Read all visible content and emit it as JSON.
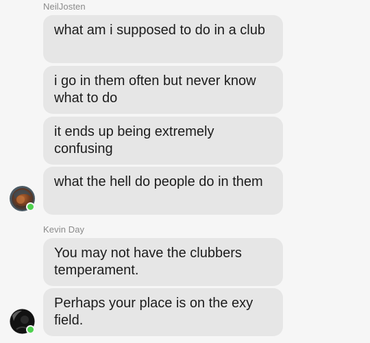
{
  "groups": [
    {
      "sender": "NeilJosten",
      "messages": [
        "what am i supposed to do in a club",
        "i go in them often but never know what to do",
        "it ends up being extremely confusing",
        "what the hell do people do in them"
      ],
      "avatar": {
        "icon": "user-avatar-icon",
        "online": true
      }
    },
    {
      "sender": "Kevin Day",
      "messages": [
        "You may not have the clubbers temperament.",
        "Perhaps your place is on the exy field."
      ],
      "avatar": {
        "icon": "user-avatar-icon",
        "online": true
      }
    }
  ],
  "colors": {
    "background": "#f6f6f6",
    "bubble": "#e6e6e6",
    "online": "#4fd14f",
    "sender": "#8a8a8a"
  }
}
